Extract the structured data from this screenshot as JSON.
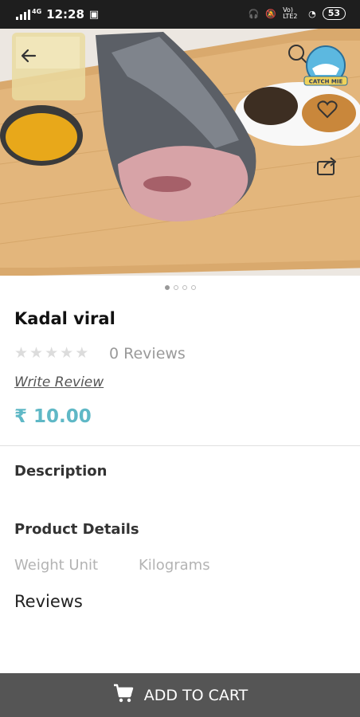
{
  "status": {
    "time": "12:28",
    "network": "4G",
    "lte": "Vo) LTE2",
    "battery": "53"
  },
  "hero": {
    "badge_text": "CATCH MIE"
  },
  "product": {
    "name": "Kadal viral",
    "rating": 0,
    "reviews_label": "0 Reviews",
    "write_review": "Write Review",
    "price": "₹ 10.00"
  },
  "carousel": {
    "total": 4,
    "active": 0
  },
  "sections": {
    "description": "Description",
    "product_details": "Product Details",
    "reviews": "Reviews"
  },
  "details": [
    {
      "key": "Weight Unit",
      "value": "Kilograms"
    }
  ],
  "cart": {
    "label": "ADD TO CART"
  },
  "colors": {
    "accent": "#5fb8c6",
    "cart_bar": "#555555"
  }
}
